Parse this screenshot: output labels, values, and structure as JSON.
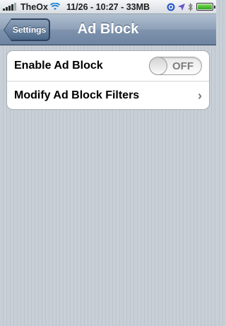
{
  "status_bar": {
    "carrier": "TheOx",
    "center": "11/26 - 10:27 - 33MB",
    "icons": [
      "signal-bars-icon",
      "wifi-icon",
      "sync-icon",
      "location-arrow-icon",
      "bluetooth-icon",
      "battery-icon"
    ]
  },
  "nav": {
    "title": "Ad Block",
    "back_label": "Settings"
  },
  "settings": {
    "enable_label": "Enable Ad Block",
    "enable_state": "OFF",
    "filters_label": "Modify Ad Block Filters",
    "chevron": "›"
  },
  "colors": {
    "nav_bar": "#7f93ad",
    "background": "#c5ccd4"
  }
}
